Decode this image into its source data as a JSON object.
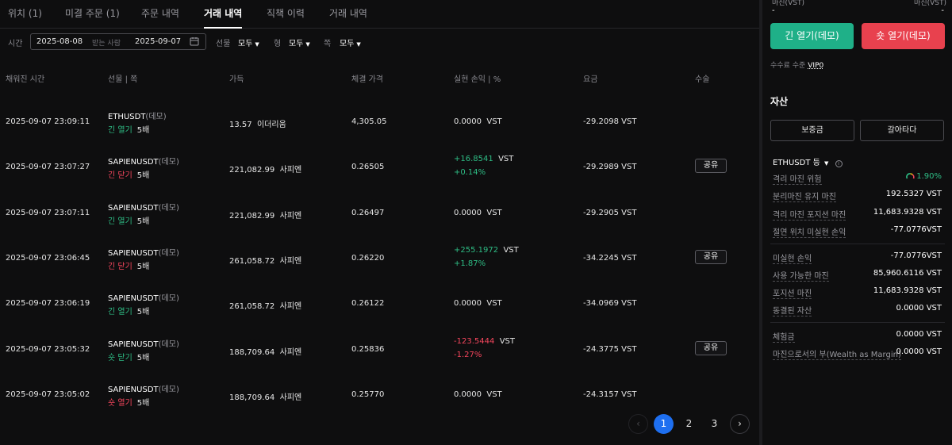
{
  "tabs": [
    {
      "label": "위치 (1)"
    },
    {
      "label": "미결 주문 (1)"
    },
    {
      "label": "주문 내역"
    },
    {
      "label": "거래 내역"
    },
    {
      "label": "직책 이력"
    },
    {
      "label": "거래 내역"
    }
  ],
  "active_tab_index": 3,
  "filters": {
    "time_label": "시간",
    "date_from": "2025-08-08",
    "date_sep": "받는 사람",
    "date_to": "2025-09-07",
    "futures_label": "선물",
    "futures_value": "모두",
    "type_label": "형",
    "type_value": "모두",
    "side_label": "쪽",
    "side_value": "모두"
  },
  "table": {
    "headers": {
      "time": "채워진 시간",
      "futures_side": "선물 | 쪽",
      "qty": "가득",
      "price": "체결 가격",
      "pnl": "실현 손익 | %",
      "fee": "요금",
      "action": "수술"
    },
    "rows": [
      {
        "time": "2025-09-07 23:09:11",
        "symbol": "ETHUSDT",
        "demo": "(데모)",
        "side": "긴 열기",
        "side_color": "#2ebd85",
        "leverage": "5배",
        "qty": "13.57",
        "qty_unit": "이더리움",
        "price": "4,305.05",
        "pnl": "0.0000",
        "pnl_pct": "",
        "pnl_unit": "VST",
        "pnl_color": "#e6e6e6",
        "fee": "-29.2098 VST",
        "share": ""
      },
      {
        "time": "2025-09-07 23:07:27",
        "symbol": "SAPIENUSDT",
        "demo": "(데모)",
        "side": "긴 닫기",
        "side_color": "#f6465d",
        "leverage": "5배",
        "qty": "221,082.99",
        "qty_unit": "사피엔",
        "price": "0.26505",
        "pnl": "+16.8541",
        "pnl_pct": "+0.14%",
        "pnl_unit": "VST",
        "pnl_color": "#2ebd85",
        "fee": "-29.2989 VST",
        "share": "공유"
      },
      {
        "time": "2025-09-07 23:07:11",
        "symbol": "SAPIENUSDT",
        "demo": "(데모)",
        "side": "긴 열기",
        "side_color": "#2ebd85",
        "leverage": "5배",
        "qty": "221,082.99",
        "qty_unit": "사피엔",
        "price": "0.26497",
        "pnl": "0.0000",
        "pnl_pct": "",
        "pnl_unit": "VST",
        "pnl_color": "#e6e6e6",
        "fee": "-29.2905 VST",
        "share": ""
      },
      {
        "time": "2025-09-07 23:06:45",
        "symbol": "SAPIENUSDT",
        "demo": "(데모)",
        "side": "긴 닫기",
        "side_color": "#f6465d",
        "leverage": "5배",
        "qty": "261,058.72",
        "qty_unit": "사피엔",
        "price": "0.26220",
        "pnl": "+255.1972",
        "pnl_pct": "+1.87%",
        "pnl_unit": "VST",
        "pnl_color": "#2ebd85",
        "fee": "-34.2245 VST",
        "share": "공유"
      },
      {
        "time": "2025-09-07 23:06:19",
        "symbol": "SAPIENUSDT",
        "demo": "(데모)",
        "side": "긴 열기",
        "side_color": "#2ebd85",
        "leverage": "5배",
        "qty": "261,058.72",
        "qty_unit": "사피엔",
        "price": "0.26122",
        "pnl": "0.0000",
        "pnl_pct": "",
        "pnl_unit": "VST",
        "pnl_color": "#e6e6e6",
        "fee": "-34.0969 VST",
        "share": ""
      },
      {
        "time": "2025-09-07 23:05:32",
        "symbol": "SAPIENUSDT",
        "demo": "(데모)",
        "side": "숏 닫기",
        "side_color": "#2ebd85",
        "leverage": "5배",
        "qty": "188,709.64",
        "qty_unit": "사피엔",
        "price": "0.25836",
        "pnl": "-123.5444",
        "pnl_pct": "-1.27%",
        "pnl_unit": "VST",
        "pnl_color": "#f6465d",
        "fee": "-24.3775 VST",
        "share": "공유"
      },
      {
        "time": "2025-09-07 23:05:02",
        "symbol": "SAPIENUSDT",
        "demo": "(데모)",
        "side": "숏 열기",
        "side_color": "#f6465d",
        "leverage": "5배",
        "qty": "188,709.64",
        "qty_unit": "사피엔",
        "price": "0.25770",
        "pnl": "0.0000",
        "pnl_pct": "",
        "pnl_unit": "VST",
        "pnl_color": "#e6e6e6",
        "fee": "-24.3157 VST",
        "share": ""
      }
    ]
  },
  "pagination": {
    "prev": "‹",
    "pages": [
      "1",
      "2",
      "3"
    ],
    "current": "1",
    "next": "›"
  },
  "right": {
    "top_left": "마진(VST)",
    "top_right": "마진(VST)",
    "top_left_value": "-",
    "top_right_value": "-",
    "long_button": "긴 열기(데모)",
    "short_button": "숏 열기(데모)",
    "fee_level_label": "수수료 수준",
    "fee_level_value": "VIP0",
    "assets_title": "자산",
    "margin_button": "보증금",
    "transfer_button": "갈아타다",
    "symbol_line": "ETHUSDT 등",
    "risk": {
      "label": "격리 마진 위험",
      "value": "1.90%"
    },
    "group1": [
      {
        "label": "분리마진 유지 마진",
        "value": "192.5327 VST"
      },
      {
        "label": "격리 마진 포지션 마진",
        "value": "11,683.9328 VST"
      },
      {
        "label": "절연 위치 미실현 손익",
        "value": "-77.0776VST"
      }
    ],
    "group2": [
      {
        "label": "미실현 손익",
        "value": "-77.0776VST"
      },
      {
        "label": "사용 가능한 마진",
        "value": "85,960.6116 VST"
      },
      {
        "label": "포지션 마진",
        "value": "11,683.9328 VST"
      },
      {
        "label": "동결된 자산",
        "value": "0.0000 VST"
      }
    ],
    "group3": [
      {
        "label": "체험금",
        "value": "0.0000 VST"
      },
      {
        "label": "마진으로서의 부(Wealth as Margin)",
        "value": "0.0000 VST"
      }
    ]
  }
}
